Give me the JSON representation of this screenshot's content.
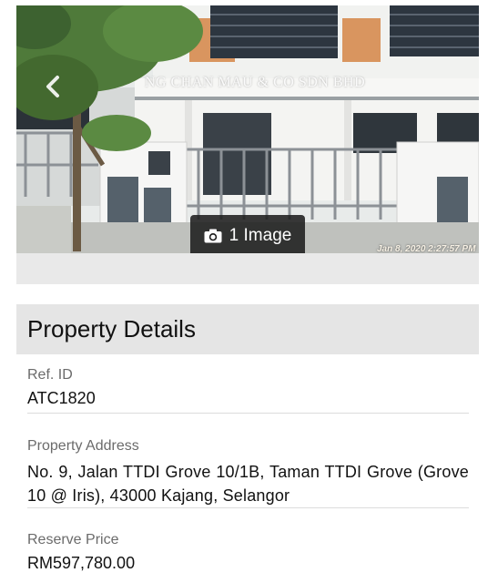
{
  "photo": {
    "watermark": "NG CHAN MAU & CO SDN BHD",
    "image_count_label": "1 Image",
    "timestamp": "Jan 8, 2020 2:27:57 PM",
    "icons": {
      "prev": "chevron-left-icon",
      "camera": "camera-icon"
    }
  },
  "details": {
    "title": "Property Details",
    "fields": [
      {
        "label": "Ref. ID",
        "value": "ATC1820"
      },
      {
        "label": "Property Address",
        "value": "No. 9, Jalan TTDI Grove 10/1B, Taman TTDI Grove (Grove 10 @ Iris), 43000 Kajang, Selangor"
      },
      {
        "label": "Reserve Price",
        "value": "RM597,780.00"
      }
    ]
  }
}
